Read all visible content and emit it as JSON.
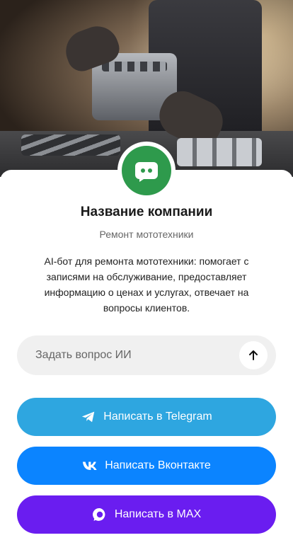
{
  "company": {
    "name": "Название компании",
    "category": "Ремонт мототехники",
    "description": "AI-бот для ремонта мототехники: помогает с записями на обслуживание, предоставляет информацию о ценах и услугах, отвечает на вопросы клиентов."
  },
  "ask": {
    "placeholder": "Задать вопрос ИИ",
    "send_icon": "arrow-up-icon"
  },
  "buttons": {
    "telegram": {
      "label": "Написать в Telegram",
      "icon": "telegram-icon",
      "color": "#2ea6e0"
    },
    "vk": {
      "label": "Написать Вконтакте",
      "icon": "vk-icon",
      "color": "#0b84ff"
    },
    "max": {
      "label": "Написать в MAX",
      "icon": "max-icon",
      "color": "#6a1df0"
    }
  },
  "colors": {
    "logo": "#2e9a4c"
  }
}
